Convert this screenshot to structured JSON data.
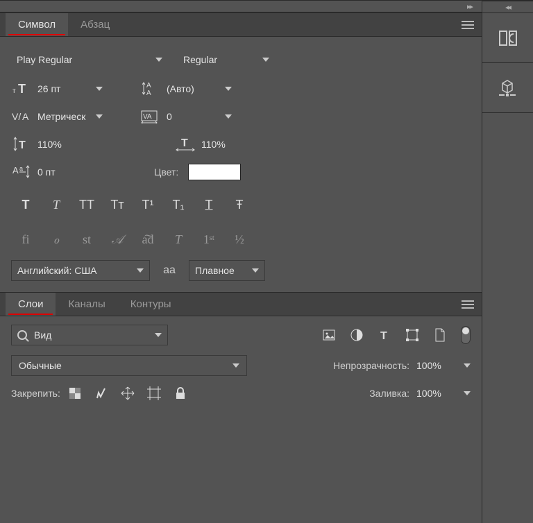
{
  "char_panel": {
    "tabs": {
      "character": "Символ",
      "paragraph": "Абзац"
    },
    "font_family": "Play Regular",
    "font_style": "Regular",
    "font_size": "26 пт",
    "leading": "(Авто)",
    "kerning": "Метрическ",
    "tracking": "0",
    "v_scale": "110%",
    "h_scale": "110%",
    "baseline": "0 пт",
    "color_label": "Цвет:",
    "color_value": "#ffffff",
    "style_buttons": [
      "T",
      "T",
      "TT",
      "Tᴛ",
      "T¹",
      "T₁",
      "T",
      "Ŧ"
    ],
    "opentype_buttons": [
      "fi",
      "ℴ",
      "st",
      "𝒜",
      "a͠d",
      "T",
      "1ˢᵗ",
      "½"
    ],
    "language": "Английский: США",
    "aa_icon": "aa",
    "antialias": "Плавное"
  },
  "layers_panel": {
    "tabs": {
      "layers": "Слои",
      "channels": "Каналы",
      "paths": "Контуры"
    },
    "filter_label": "Вид",
    "blend_mode": "Обычные",
    "opacity_label": "Непрозрачность:",
    "opacity_value": "100%",
    "lock_label": "Закрепить:",
    "fill_label": "Заливка:",
    "fill_value": "100%"
  }
}
